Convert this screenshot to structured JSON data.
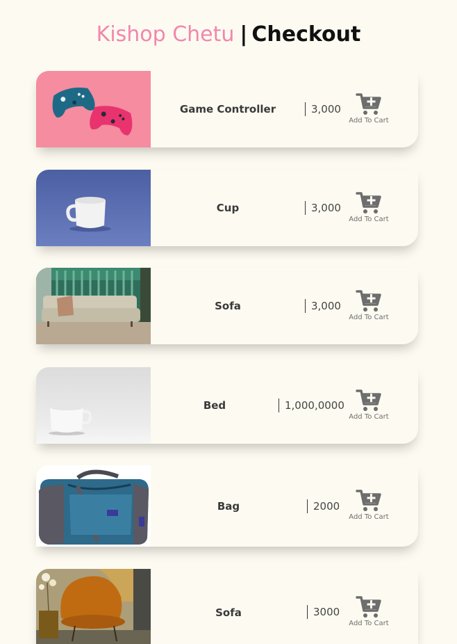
{
  "header": {
    "brand": "Kishop Chetu",
    "separator": "|",
    "title": "Checkout"
  },
  "products": [
    {
      "name": "Game Controller",
      "price": "3,000",
      "add_label": "Add To Cart",
      "image": "game-controllers"
    },
    {
      "name": "Cup",
      "price": "3,000",
      "add_label": "Add To Cart",
      "image": "white-mug-blue-bg"
    },
    {
      "name": "Sofa",
      "price": "3,000",
      "add_label": "Add To Cart",
      "image": "sofa-living-room"
    },
    {
      "name": "Bed",
      "price": "1,000,0000",
      "add_label": "Add To Cart",
      "image": "white-mug-grey-bg"
    },
    {
      "name": "Bag",
      "price": "2000",
      "add_label": "Add To Cart",
      "image": "blue-duffel-bag"
    },
    {
      "name": "Sofa",
      "price": "3000",
      "add_label": "Add To Cart",
      "image": "orange-armchair"
    }
  ],
  "colors": {
    "background": "#fdfbf1",
    "brand": "#f386ad",
    "icon": "#6d6d6d"
  },
  "icons": {
    "cart": "add-to-cart-icon"
  }
}
